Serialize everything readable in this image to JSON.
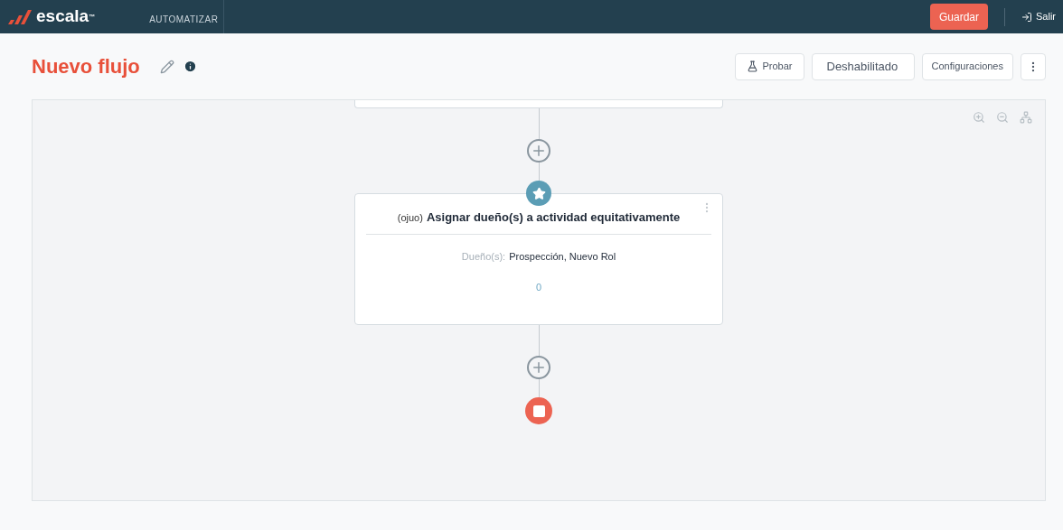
{
  "header": {
    "logo": "escala",
    "logo_mark": "™",
    "section": "AUTOMATIZAR",
    "save_button": "Guardar",
    "exit_link": "Salir"
  },
  "page": {
    "title": "Nuevo flujo",
    "actions": [
      {
        "kind": "icon-text",
        "label": "Probar"
      },
      {
        "kind": "dropdown",
        "label": "Deshabilitado"
      },
      {
        "kind": "text",
        "label": "Configuraciones"
      },
      {
        "kind": "more"
      }
    ]
  },
  "canvas": {
    "nodes": [
      {
        "kind": "partial"
      },
      {
        "kind": "add"
      },
      {
        "kind": "action",
        "prefix": "(ojuo)",
        "title": "Asignar dueño(s) a actividad equitativamente",
        "field_label": "Dueño(s):",
        "field_value": "Prospección, Nuevo Rol",
        "count": "0"
      },
      {
        "kind": "add"
      },
      {
        "kind": "end"
      }
    ]
  }
}
